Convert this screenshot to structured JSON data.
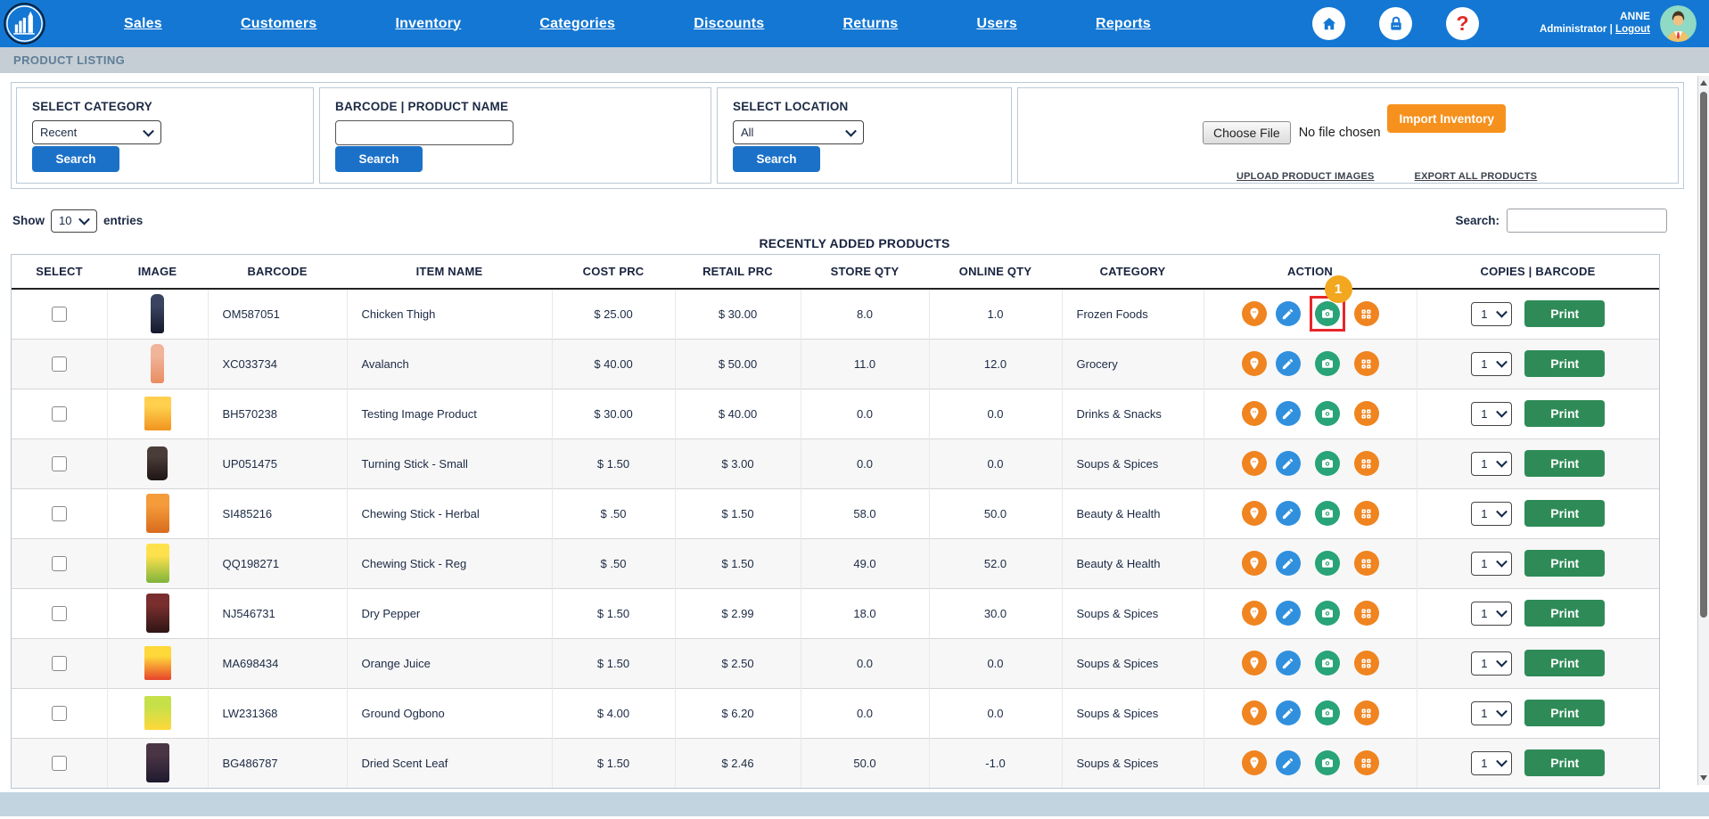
{
  "nav": {
    "items": [
      "Sales",
      "Customers",
      "Inventory",
      "Categories",
      "Discounts",
      "Returns",
      "Users",
      "Reports"
    ],
    "user_name": "ANNE",
    "user_role": "Administrator",
    "logout_label": "Logout",
    "icons": [
      "app-logo-icon",
      "home-icon",
      "lock-icon",
      "help-icon",
      "user-avatar"
    ]
  },
  "breadcrumb": "PRODUCT LISTING",
  "filters": {
    "category": {
      "label": "SELECT CATEGORY",
      "value": "Recent",
      "button": "Search"
    },
    "barcode": {
      "label": "BARCODE | PRODUCT NAME",
      "value": "",
      "button": "Search"
    },
    "location": {
      "label": "SELECT LOCATION",
      "value": "All",
      "button": "Search"
    },
    "import": {
      "choose_file": "Choose File",
      "no_file": "No file chosen",
      "import_button": "Import Inventory",
      "upload_link": "UPLOAD PRODUCT IMAGES",
      "export_link": "EXPORT ALL PRODUCTS"
    }
  },
  "entries": {
    "show_label": "Show",
    "value": "10",
    "entries_label": "entries",
    "search_label": "Search:",
    "search_value": ""
  },
  "table": {
    "title": "RECENTLY ADDED PRODUCTS",
    "columns": [
      "SELECT",
      "IMAGE",
      "BARCODE",
      "ITEM NAME",
      "COST PRC",
      "RETAIL PRC",
      "STORE QTY",
      "ONLINE QTY",
      "CATEGORY",
      "ACTION",
      "COPIES  |  BARCODE"
    ],
    "copies_value": "1",
    "print_label": "Print",
    "badge": "1",
    "action_icons": [
      "location-pin-icon",
      "edit-pencil-icon",
      "camera-icon",
      "barcode-grid-icon"
    ],
    "rows": [
      {
        "barcode": "OM587051",
        "item": "Chicken Thigh",
        "cost": "$ 25.00",
        "retail": "$ 30.00",
        "store": "8.0",
        "online": "1.0",
        "category": "Frozen Foods",
        "shape": "bottle",
        "img_c1": "#3a4460",
        "img_c2": "#14182b",
        "highlight": true
      },
      {
        "barcode": "XC033734",
        "item": "Avalanch",
        "cost": "$ 40.00",
        "retail": "$ 50.00",
        "store": "11.0",
        "online": "12.0",
        "category": "Grocery",
        "shape": "bottle",
        "img_c1": "#f0b49a",
        "img_c2": "#e98d60",
        "highlight": false
      },
      {
        "barcode": "BH570238",
        "item": "Testing Image Product",
        "cost": "$ 30.00",
        "retail": "$ 40.00",
        "store": "0.0",
        "online": "0.0",
        "category": "Drinks & Snacks",
        "shape": "box",
        "img_c1": "#ffcf4d",
        "img_c2": "#f0941f",
        "highlight": false
      },
      {
        "barcode": "UP051475",
        "item": "Turning Stick - Small",
        "cost": "$ 1.50",
        "retail": "$ 3.00",
        "store": "0.0",
        "online": "0.0",
        "category": "Soups & Spices",
        "shape": "jar",
        "img_c1": "#4a3c38",
        "img_c2": "#1e1516",
        "highlight": false
      },
      {
        "barcode": "SI485216",
        "item": "Chewing Stick - Herbal",
        "cost": "$ .50",
        "retail": "$ 1.50",
        "store": "58.0",
        "online": "50.0",
        "category": "Beauty & Health",
        "shape": "packet",
        "img_c1": "#f49b3a",
        "img_c2": "#d96c1e",
        "highlight": false
      },
      {
        "barcode": "QQ198271",
        "item": "Chewing Stick - Reg",
        "cost": "$ .50",
        "retail": "$ 1.50",
        "store": "49.0",
        "online": "52.0",
        "category": "Beauty & Health",
        "shape": "packet",
        "img_c1": "#ffe14d",
        "img_c2": "#7fb43c",
        "highlight": false
      },
      {
        "barcode": "NJ546731",
        "item": "Dry Pepper",
        "cost": "$ 1.50",
        "retail": "$ 2.99",
        "store": "18.0",
        "online": "30.0",
        "category": "Soups & Spices",
        "shape": "packet",
        "img_c1": "#7a2e2e",
        "img_c2": "#2e1515",
        "highlight": false
      },
      {
        "barcode": "MA698434",
        "item": "Orange Juice",
        "cost": "$ 1.50",
        "retail": "$ 2.50",
        "store": "0.0",
        "online": "0.0",
        "category": "Soups & Spices",
        "shape": "box",
        "img_c1": "#ffd83a",
        "img_c2": "#e8442a",
        "highlight": false
      },
      {
        "barcode": "LW231368",
        "item": "Ground Ogbono",
        "cost": "$ 4.00",
        "retail": "$ 6.20",
        "store": "0.0",
        "online": "0.0",
        "category": "Soups & Spices",
        "shape": "box",
        "img_c1": "#c6e04a",
        "img_c2": "#ffd83a",
        "highlight": false
      },
      {
        "barcode": "BG486787",
        "item": "Dried Scent Leaf",
        "cost": "$ 1.50",
        "retail": "$ 2.46",
        "store": "50.0",
        "online": "-1.0",
        "category": "Soups & Spices",
        "shape": "packet",
        "img_c1": "#4a3545",
        "img_c2": "#1f1a2e",
        "highlight": false
      }
    ]
  },
  "colors": {
    "nav_blue": "#1377d3",
    "breadcrumb_bg": "#c5ced5",
    "button_blue": "#1b71c8",
    "import_orange": "#f6911e",
    "print_green": "#2e8b57",
    "icon_orange": "#ef8420",
    "icon_blue": "#3090de",
    "icon_green": "#29a378",
    "badge_orange": "#f2a71f",
    "highlight_red": "#e8262a",
    "text_navy": "#1c2a44",
    "footer_bg": "#c2d4e0"
  }
}
